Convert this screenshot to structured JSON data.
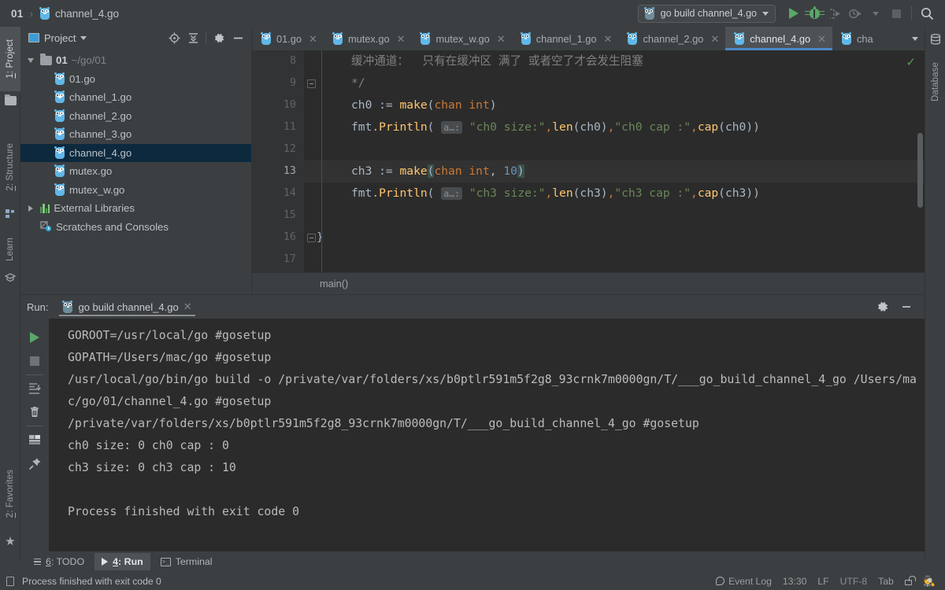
{
  "breadcrumb": {
    "project": "01",
    "separator": "›",
    "file": "channel_4.go",
    "icon": "go-file-icon"
  },
  "toolbar": {
    "run_config": "go build channel_4.go",
    "run_icon": "run-icon",
    "debug_icon": "debug-icon",
    "run_coverage_icon": "run-with-coverage-icon",
    "profile_icon": "profile-icon",
    "stop_icon": "stop-icon",
    "search_icon": "search-everywhere-icon"
  },
  "left_strip": {
    "tabs": [
      {
        "num": "1",
        "label": ": Project",
        "icon": "project-icon",
        "active": true
      },
      {
        "num": "2",
        "label": ": Structure",
        "icon": "structure-icon",
        "active": false
      },
      {
        "num": "",
        "label": "Learn",
        "icon": "learn-icon",
        "active": false
      },
      {
        "num": "2",
        "label": ": Favorites",
        "icon": "favorites-star-icon",
        "active": false
      }
    ]
  },
  "right_strip": {
    "tabs": [
      {
        "label": "Database",
        "icon": "database-icon"
      }
    ]
  },
  "project_panel": {
    "title": "Project",
    "icons": [
      "locate-icon",
      "collapse-all-icon",
      "gear-icon",
      "hide-icon"
    ],
    "tree": [
      {
        "indent": 0,
        "twisty": "down",
        "icon": "folder-icon",
        "name": "01",
        "path": "~/go/01",
        "selected": false,
        "bold": true
      },
      {
        "indent": 1,
        "twisty": "none",
        "icon": "go-file-icon",
        "name": "01.go",
        "path": "",
        "selected": false,
        "bold": false
      },
      {
        "indent": 1,
        "twisty": "none",
        "icon": "go-file-icon",
        "name": "channel_1.go",
        "path": "",
        "selected": false,
        "bold": false
      },
      {
        "indent": 1,
        "twisty": "none",
        "icon": "go-file-icon",
        "name": "channel_2.go",
        "path": "",
        "selected": false,
        "bold": false
      },
      {
        "indent": 1,
        "twisty": "none",
        "icon": "go-file-icon",
        "name": "channel_3.go",
        "path": "",
        "selected": false,
        "bold": false
      },
      {
        "indent": 1,
        "twisty": "none",
        "icon": "go-file-icon",
        "name": "channel_4.go",
        "path": "",
        "selected": true,
        "bold": false
      },
      {
        "indent": 1,
        "twisty": "none",
        "icon": "go-file-icon",
        "name": "mutex.go",
        "path": "",
        "selected": false,
        "bold": false
      },
      {
        "indent": 1,
        "twisty": "none",
        "icon": "go-file-icon",
        "name": "mutex_w.go",
        "path": "",
        "selected": false,
        "bold": false
      },
      {
        "indent": 0,
        "twisty": "right",
        "icon": "external-libraries-icon",
        "name": "External Libraries",
        "path": "",
        "selected": false,
        "bold": false
      },
      {
        "indent": 0,
        "twisty": "none",
        "icon": "scratches-icon",
        "name": "Scratches and Consoles",
        "path": "",
        "selected": false,
        "bold": false
      }
    ]
  },
  "editor": {
    "tabs": [
      {
        "label": "01.go",
        "active": false
      },
      {
        "label": "mutex.go",
        "active": false
      },
      {
        "label": "mutex_w.go",
        "active": false
      },
      {
        "label": "channel_1.go",
        "active": false
      },
      {
        "label": "channel_2.go",
        "active": false
      },
      {
        "label": "channel_4.go",
        "active": true
      },
      {
        "label": "cha",
        "active": false
      }
    ],
    "more_tabs_icon": "chevron-down-icon",
    "inspection_status": "✓",
    "first_line_number": 8,
    "caret_line": 13,
    "lines": [
      {
        "n": 8,
        "fold": false,
        "caret": false,
        "tokens": [
          {
            "t": "comment",
            "v": "缓冲通道：  只有在缓冲区 满了 或者空了才会发生阻塞"
          }
        ]
      },
      {
        "n": 9,
        "fold": true,
        "caret": false,
        "tokens": [
          {
            "t": "comment",
            "v": "*/"
          }
        ]
      },
      {
        "n": 10,
        "fold": false,
        "caret": false,
        "tokens": [
          {
            "t": "txt",
            "v": "ch0 := "
          },
          {
            "t": "fn",
            "v": "make"
          },
          {
            "t": "txt",
            "v": "("
          },
          {
            "t": "kw",
            "v": "chan int"
          },
          {
            "t": "txt",
            "v": ")"
          }
        ]
      },
      {
        "n": 11,
        "fold": false,
        "caret": false,
        "tokens": [
          {
            "t": "txt",
            "v": "fmt."
          },
          {
            "t": "fn",
            "v": "Println"
          },
          {
            "t": "txt",
            "v": "( "
          },
          {
            "t": "hint",
            "v": "a…:"
          },
          {
            "t": "str",
            "v": " \"ch0 size:\""
          },
          {
            "t": "kw",
            "v": ","
          },
          {
            "t": "fn",
            "v": "len"
          },
          {
            "t": "txt",
            "v": "(ch0)"
          },
          {
            "t": "kw",
            "v": ","
          },
          {
            "t": "str",
            "v": "\"ch0 cap :\""
          },
          {
            "t": "kw",
            "v": ","
          },
          {
            "t": "fn",
            "v": "cap"
          },
          {
            "t": "txt",
            "v": "(ch0))"
          }
        ]
      },
      {
        "n": 12,
        "fold": false,
        "caret": false,
        "tokens": []
      },
      {
        "n": 13,
        "fold": false,
        "caret": true,
        "tokens": [
          {
            "t": "txt",
            "v": "ch3 := "
          },
          {
            "t": "fn",
            "v": "make"
          },
          {
            "t": "brkt",
            "v": "("
          },
          {
            "t": "kw",
            "v": "chan int"
          },
          {
            "t": "txt",
            "v": ", "
          },
          {
            "t": "num",
            "v": "10"
          },
          {
            "t": "brkt",
            "v": ")"
          }
        ]
      },
      {
        "n": 14,
        "fold": false,
        "caret": false,
        "tokens": [
          {
            "t": "txt",
            "v": "fmt."
          },
          {
            "t": "fn",
            "v": "Println"
          },
          {
            "t": "txt",
            "v": "( "
          },
          {
            "t": "hint",
            "v": "a…:"
          },
          {
            "t": "str",
            "v": " \"ch3 size:\""
          },
          {
            "t": "kw",
            "v": ","
          },
          {
            "t": "fn",
            "v": "len"
          },
          {
            "t": "txt",
            "v": "(ch3)"
          },
          {
            "t": "kw",
            "v": ","
          },
          {
            "t": "str",
            "v": "\"ch3 cap :\""
          },
          {
            "t": "kw",
            "v": ","
          },
          {
            "t": "fn",
            "v": "cap"
          },
          {
            "t": "txt",
            "v": "(ch3))"
          }
        ]
      },
      {
        "n": 15,
        "fold": false,
        "caret": false,
        "tokens": []
      },
      {
        "n": 16,
        "fold": true,
        "caret": false,
        "tokens": [
          {
            "t": "txt",
            "v": "}",
            "nopad": true
          }
        ]
      },
      {
        "n": 17,
        "fold": false,
        "caret": false,
        "tokens": []
      }
    ],
    "breadcrumb_bottom": "main()"
  },
  "run_panel": {
    "label": "Run:",
    "tab": "go build channel_4.go",
    "tab_icon": "go-run-icon",
    "close_icon": "close-icon",
    "settings_icon": "gear-icon",
    "minimize_icon": "hide-icon",
    "toolbar_icons": [
      "rerun-icon",
      "stop-icon",
      "scroll-to-end-icon",
      "trash-icon",
      "print-icon",
      "pin-icon"
    ],
    "console": [
      "GOROOT=/usr/local/go #gosetup",
      "GOPATH=/Users/mac/go #gosetup",
      "/usr/local/go/bin/go build -o /private/var/folders/xs/b0ptlr591m5f2g8_93crnk7m0000gn/T/___go_build_channel_4_go /Users/mac/go/01/channel_4.go #gosetup",
      "/private/var/folders/xs/b0ptlr591m5f2g8_93crnk7m0000gn/T/___go_build_channel_4_go #gosetup",
      "ch0 size: 0 ch0 cap : 0",
      "ch3 size: 0 ch3 cap : 10",
      "",
      "Process finished with exit code 0"
    ]
  },
  "bottom_bar": {
    "tabs": [
      {
        "num": "6",
        "label": ": TODO",
        "icon": "todo-list-icon",
        "active": false
      },
      {
        "num": "4",
        "label": ": Run",
        "icon": "run-icon",
        "active": true
      },
      {
        "num": "",
        "label": "Terminal",
        "icon": "terminal-icon",
        "active": false
      }
    ]
  },
  "status_bar": {
    "message": "Process finished with exit code 0",
    "event_log": "Event Log",
    "time": "13:30",
    "line_separator": "LF",
    "encoding": "UTF-8",
    "indent": "Tab",
    "lock_icon": "lock-icon",
    "inspection_icon": "hector-icon",
    "doc_icon": "document-icon"
  },
  "colors": {
    "accent_blue": "#4a88c7",
    "selection": "#0d293e",
    "editor_bg": "#2b2b2b",
    "chrome_bg": "#3c3f41",
    "green": "#59a869",
    "go_blue": "#60b7e8"
  }
}
